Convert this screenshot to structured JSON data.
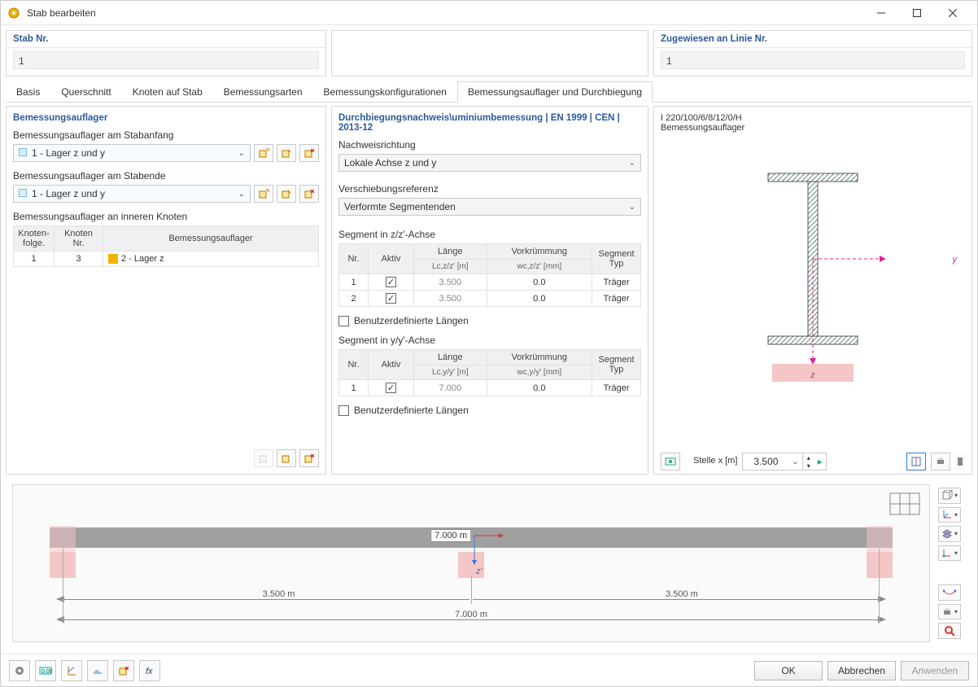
{
  "window": {
    "title": "Stab bearbeiten"
  },
  "top": {
    "stab_label": "Stab Nr.",
    "stab_value": "1",
    "line_label": "Zugewiesen an Linie Nr.",
    "line_value": "1"
  },
  "tabs": {
    "items": [
      "Basis",
      "Querschnitt",
      "Knoten auf Stab",
      "Bemessungsarten",
      "Bemessungskonfigurationen",
      "Bemessungsauflager und Durchbiegung"
    ],
    "active": 5
  },
  "left": {
    "title": "Bemessungsauflager",
    "start_label": "Bemessungsauflager am Stabanfang",
    "start_value": "1 - Lager z und y",
    "end_label": "Bemessungsauflager am Stabende",
    "end_value": "1 - Lager z und y",
    "inner_label": "Bemessungsauflager an inneren Knoten",
    "headers": {
      "seq": "Knoten-\nfolge.",
      "node": "Knoten\nNr.",
      "support": "Bemessungsauflager"
    },
    "row": {
      "seq": "1",
      "node": "3",
      "support": "2 - Lager z",
      "color": "#f0b400"
    }
  },
  "mid": {
    "title": "Durchbiegungsnachweis\\uminiumbemessung | EN 1999 | CEN | 2013-12",
    "dir_label": "Nachweisrichtung",
    "dir_value": "Lokale Achse z und y",
    "ref_label": "Verschiebungsreferenz",
    "ref_value": "Verformte Segmentenden",
    "seg_z_label": "Segment in z/z'-Achse",
    "seg_y_label": "Segment in y/y'-Achse",
    "headers": {
      "nr": "Nr.",
      "active": "Aktiv",
      "len": "Länge",
      "len_z": "Lc,z/z' [m]",
      "len_y": "Lc,y/y' [m]",
      "pre": "Vorkrümmung",
      "pre_z": "wc,z/z' [mm]",
      "pre_y": "wc,y/y' [mm]",
      "type": "Segment\nTyp"
    },
    "rows_z": [
      {
        "nr": "1",
        "active": true,
        "len": "3.500",
        "pre": "0.0",
        "type": "Träger"
      },
      {
        "nr": "2",
        "active": true,
        "len": "3.500",
        "pre": "0.0",
        "type": "Träger"
      }
    ],
    "rows_y": [
      {
        "nr": "1",
        "active": true,
        "len": "7.000",
        "pre": "0.0",
        "type": "Träger"
      }
    ],
    "custom_len": "Benutzerdefinierte Längen"
  },
  "right": {
    "section": "I 220/100/6/8/12/0/H",
    "subtitle": "Bemessungsauflager",
    "pos_label": "Stelle x [m]",
    "pos_value": "3.500",
    "axes": {
      "y": "y",
      "z": "z"
    }
  },
  "viz": {
    "total_len": "7.000 m",
    "half_len": "3.500 m",
    "label": "7.000 m",
    "z_axis": "z'"
  },
  "footer": {
    "ok": "OK",
    "cancel": "Abbrechen",
    "apply": "Anwenden"
  }
}
